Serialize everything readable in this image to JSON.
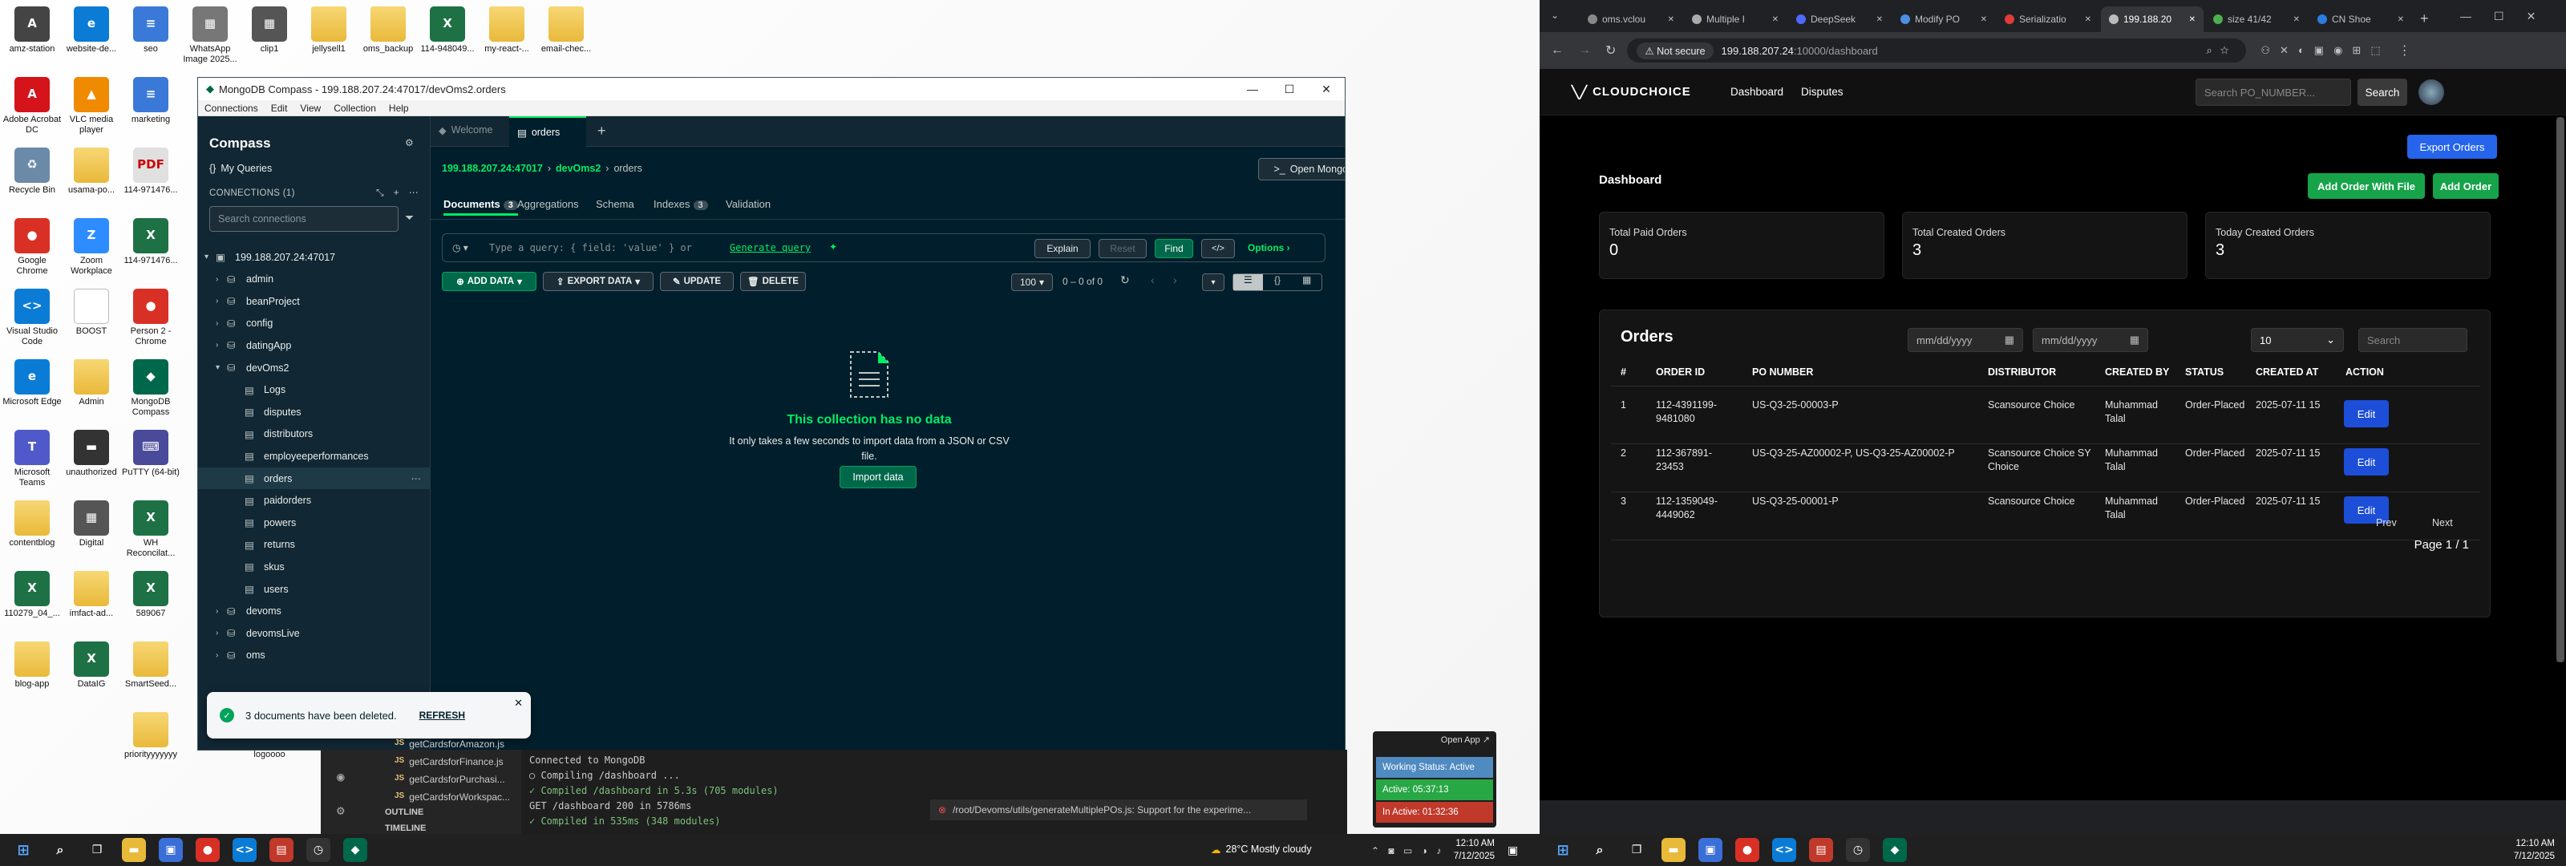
{
  "desktop": {
    "icons": [
      {
        "label": "amz-station",
        "glyph": "A",
        "color": "#444"
      },
      {
        "label": "website-de...",
        "glyph": "e",
        "color": "#0a7cd6"
      },
      {
        "label": "seo",
        "glyph": "≡",
        "color": "#3a79d8"
      },
      {
        "label": "WhatsApp Image 2025...",
        "glyph": "▦",
        "color": "#777"
      },
      {
        "label": "clip1",
        "glyph": "▦",
        "color": "#555"
      },
      {
        "label": "jellysell1",
        "glyph": "",
        "color": "folder"
      },
      {
        "label": "oms_backup",
        "glyph": "",
        "color": "folder"
      },
      {
        "label": "114-948049...",
        "glyph": "X",
        "color": "excel"
      },
      {
        "label": "my-react-...",
        "glyph": "",
        "color": "folder"
      },
      {
        "label": "email-chec...",
        "glyph": "",
        "color": "folder"
      },
      {
        "label": "Adobe Acrobat DC",
        "glyph": "A",
        "color": "#d4131a"
      },
      {
        "label": "VLC media player",
        "glyph": "▲",
        "color": "#f08a00"
      },
      {
        "label": "marketing",
        "glyph": "≡",
        "color": "#3a79d8"
      },
      {
        "label": "Recycle Bin",
        "glyph": "♻",
        "color": "#6a8aa8"
      },
      {
        "label": "usama-po...",
        "glyph": "",
        "color": "folder"
      },
      {
        "label": "114-971476...",
        "glyph": "PDF",
        "color": "pdf"
      },
      {
        "label": "Google Chrome",
        "glyph": "●",
        "color": "#d93025"
      },
      {
        "label": "Zoom Workplace",
        "glyph": "Z",
        "color": "#2d8cff"
      },
      {
        "label": "114-971476...",
        "glyph": "X",
        "color": "excel"
      },
      {
        "label": "Visual Studio Code",
        "glyph": "<>",
        "color": "#0a7cd6"
      },
      {
        "label": "BOOST",
        "glyph": "",
        "color": "doc"
      },
      {
        "label": "Person 2 - Chrome",
        "glyph": "●",
        "color": "#d93025"
      },
      {
        "label": "Microsoft Edge",
        "glyph": "e",
        "color": "#0a7cd6"
      },
      {
        "label": "Admin",
        "glyph": "",
        "color": "folder"
      },
      {
        "label": "MongoDB Compass",
        "glyph": "◆",
        "color": "#00684a"
      },
      {
        "label": "Microsoft Teams",
        "glyph": "T",
        "color": "#5059c9"
      },
      {
        "label": "unauthorized",
        "glyph": "▬",
        "color": "#333"
      },
      {
        "label": "PuTTY (64-bit)",
        "glyph": "⌨",
        "color": "#4a4a9a"
      },
      {
        "label": "contentblog",
        "glyph": "",
        "color": "folder"
      },
      {
        "label": "Digital",
        "glyph": "▦",
        "color": "#555"
      },
      {
        "label": "WH Reconcilat...",
        "glyph": "X",
        "color": "excel"
      },
      {
        "label": "110279_04_...",
        "glyph": "X",
        "color": "excel"
      },
      {
        "label": "imfact-ad...",
        "glyph": "",
        "color": "folder"
      },
      {
        "label": "589067",
        "glyph": "X",
        "color": "excel"
      },
      {
        "label": "blog-app",
        "glyph": "",
        "color": "folder"
      },
      {
        "label": "DataIG",
        "glyph": "X",
        "color": "excel"
      },
      {
        "label": "SmartSeed...",
        "glyph": "",
        "color": "folder"
      },
      {
        "label": "priorityyyyyyy",
        "glyph": "",
        "color": "folder"
      },
      {
        "label": "logoooo",
        "glyph": "",
        "color": "doc"
      }
    ]
  },
  "compass": {
    "window_title": "MongoDB Compass - 199.188.207.24:47017/devOms2.orders",
    "menu": [
      "Connections",
      "Edit",
      "View",
      "Collection",
      "Help"
    ],
    "top_tabs": {
      "welcome": "Welcome",
      "orders": "orders"
    },
    "sidebar": {
      "title": "Compass",
      "my_queries": "My Queries",
      "connections_label": "CONNECTIONS (1)",
      "search_placeholder": "Search connections",
      "host": "199.188.207.24:47017",
      "dbs_before": [
        "admin",
        "beanProject",
        "config",
        "datingApp"
      ],
      "open_db": "devOms2",
      "collections": [
        "Logs",
        "disputes",
        "distributors",
        "employeeperformances",
        "orders",
        "paidorders",
        "powers",
        "returns",
        "skus",
        "users"
      ],
      "dbs_after": [
        "devoms",
        "devomsLive"
      ],
      "truncated": "oms"
    },
    "breadcrumb": {
      "host": "199.188.207.24:47017",
      "db": "devOms2",
      "coll": "orders"
    },
    "shell_button": "Open MongoDB shell",
    "coll_tabs": [
      {
        "label": "Documents",
        "count": "3"
      },
      {
        "label": "Aggregations",
        "count": ""
      },
      {
        "label": "Schema",
        "count": ""
      },
      {
        "label": "Indexes",
        "count": "3"
      },
      {
        "label": "Validation",
        "count": ""
      }
    ],
    "query_placeholder": "Type a query: { field: 'value' } or",
    "generate_query": "Generate query",
    "explain": "Explain",
    "reset": "Reset",
    "find": "Find",
    "options": "Options",
    "add_data": "ADD DATA",
    "export_data": "EXPORT DATA",
    "update": "UPDATE",
    "delete": "DELETE",
    "page_size": "100",
    "range": "0 – 0 of 0",
    "empty_title": "This collection has no data",
    "empty_body": "It only takes a few seconds to import data from a JSON or CSV file.",
    "import_button": "Import data",
    "toast": {
      "message": "3 documents have been deleted.",
      "action": "REFRESH"
    }
  },
  "vscode": {
    "files": [
      "getCardsforAmazon.js",
      "getCardsforFinance.js",
      "getCardsforPurchasi...",
      "getCardsforWorkspac..."
    ],
    "outline": "OUTLINE",
    "timeline": "TIMELINE",
    "terminal": [
      "Connected to MongoDB",
      "○ Compiling /dashboard ...",
      "✓ Compiled /dashboard in 5.3s (705 modules)",
      "GET /dashboard 200 in 5786ms",
      "✓ Compiled in 535ms (348 modules)"
    ],
    "error_note": "/root/Devoms/utils/generateMultiplePOs.js: Support for the experime..."
  },
  "status_widget": {
    "open_app": "Open App ↗",
    "working": "Working Status: Active",
    "active": "Active: 05:37:13",
    "inactive": "In Active: 01:32:36"
  },
  "taskbar_left": {
    "weather": "28°C  Mostly cloudy",
    "time": "12:10 AM",
    "date": "7/12/2025"
  },
  "browser": {
    "tabs": [
      {
        "label": "oms.vclou",
        "color": "#888"
      },
      {
        "label": "Multiple I",
        "color": "#aaa"
      },
      {
        "label": "DeepSeek",
        "color": "#4d6bfe"
      },
      {
        "label": "Modify PO",
        "color": "#4a90e2"
      },
      {
        "label": "Serializatio",
        "color": "#e23b3b"
      },
      {
        "label": "199.188.20",
        "color": "#bbb"
      },
      {
        "label": "size 41/42",
        "color": "#4caf50"
      },
      {
        "label": "CN Shoe",
        "color": "#2a7de1"
      }
    ],
    "not_secure": "Not secure",
    "url_host": "199.188.207.24",
    "url_rest": ":10000/dashboard"
  },
  "app": {
    "logo": "CLOUDCHOICE",
    "nav": [
      "Dashboard",
      "Disputes"
    ],
    "search_placeholder": "Search PO_NUMBER...",
    "search_button": "Search",
    "export_button": "Export Orders",
    "page_title": "Dashboard",
    "add_file_button": "Add Order With File",
    "add_button": "Add Order",
    "stats": [
      {
        "label": "Total Paid Orders",
        "value": "0"
      },
      {
        "label": "Total Created Orders",
        "value": "3"
      },
      {
        "label": "Today Created Orders",
        "value": "3"
      }
    ],
    "orders_title": "Orders",
    "date_placeholder": "mm/dd/yyyy",
    "page_size": "10",
    "filter_placeholder": "Search",
    "columns": [
      "#",
      "ORDER ID",
      "PO NUMBER",
      "DISTRIBUTOR",
      "CREATED BY",
      "STATUS",
      "CREATED AT",
      "ACTION"
    ],
    "rows": [
      {
        "n": "1",
        "order_id": "112-4391199-9481080",
        "po": "US-Q3-25-00003-P",
        "dist": "Scansource Choice",
        "by": "Muhammad Talal",
        "status": "Order-Placed",
        "at": "2025-07-11 15",
        "action": "Edit"
      },
      {
        "n": "2",
        "order_id": "112-367891-23453",
        "po": "US-Q3-25-AZ00002-P, US-Q3-25-AZ00002-P",
        "dist": "Scansource Choice SY Choice",
        "by": "Muhammad Talal",
        "status": "Order-Placed",
        "at": "2025-07-11 15",
        "action": "Edit"
      },
      {
        "n": "3",
        "order_id": "112-1359049-4449062",
        "po": "US-Q3-25-00001-P",
        "dist": "Scansource Choice",
        "by": "Muhammad Talal",
        "status": "Order-Placed",
        "at": "2025-07-11 15",
        "action": "Edit"
      }
    ],
    "prev": "Prev",
    "next": "Next",
    "page_info": "Page 1 / 1"
  },
  "taskbar_right": {
    "time": "12:10 AM",
    "date": "7/12/2025"
  }
}
